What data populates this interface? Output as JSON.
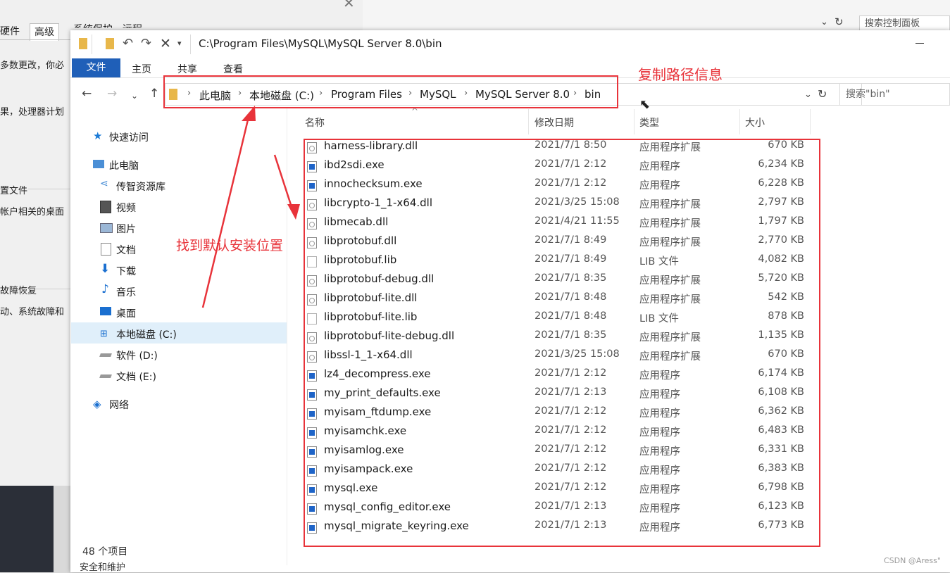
{
  "background_dialog": {
    "tabs": [
      "硬件",
      "高级",
      "系统保护",
      "远程"
    ],
    "lines": [
      "多数更改，你必",
      "果，处理器计划",
      "置文件",
      "帐户相关的桌面",
      "故障恢复",
      "动、系统故障和"
    ]
  },
  "control_panel": {
    "search_placeholder": "搜索控制面板"
  },
  "window": {
    "title_path": "C:\\Program Files\\MySQL\\MySQL Server 8.0\\bin",
    "ribbon_tabs": [
      "文件",
      "主页",
      "共享",
      "查看"
    ],
    "breadcrumb": [
      "此电脑",
      "本地磁盘 (C:)",
      "Program Files",
      "MySQL",
      "MySQL Server 8.0",
      "bin"
    ],
    "search_placeholder": "搜索\"bin\""
  },
  "nav_pane": {
    "items": [
      "快速访问",
      "此电脑",
      "传智资源库",
      "视频",
      "图片",
      "文档",
      "下载",
      "音乐",
      "桌面",
      "本地磁盘 (C:)",
      "软件 (D:)",
      "文档 (E:)",
      "网络"
    ]
  },
  "columns": [
    "名称",
    "修改日期",
    "类型",
    "大小"
  ],
  "files": [
    {
      "name": "harness-library.dll",
      "date": "2021/7/1 8:50",
      "type": "应用程序扩展",
      "size": "670 KB",
      "kind": "dll"
    },
    {
      "name": "ibd2sdi.exe",
      "date": "2021/7/1 2:12",
      "type": "应用程序",
      "size": "6,234 KB",
      "kind": "exe"
    },
    {
      "name": "innochecksum.exe",
      "date": "2021/7/1 2:12",
      "type": "应用程序",
      "size": "6,228 KB",
      "kind": "exe"
    },
    {
      "name": "libcrypto-1_1-x64.dll",
      "date": "2021/3/25 15:08",
      "type": "应用程序扩展",
      "size": "2,797 KB",
      "kind": "dll"
    },
    {
      "name": "libmecab.dll",
      "date": "2021/4/21 11:55",
      "type": "应用程序扩展",
      "size": "1,797 KB",
      "kind": "dll"
    },
    {
      "name": "libprotobuf.dll",
      "date": "2021/7/1 8:49",
      "type": "应用程序扩展",
      "size": "2,770 KB",
      "kind": "dll"
    },
    {
      "name": "libprotobuf.lib",
      "date": "2021/7/1 8:49",
      "type": "LIB 文件",
      "size": "4,082 KB",
      "kind": "lib"
    },
    {
      "name": "libprotobuf-debug.dll",
      "date": "2021/7/1 8:35",
      "type": "应用程序扩展",
      "size": "5,720 KB",
      "kind": "dll"
    },
    {
      "name": "libprotobuf-lite.dll",
      "date": "2021/7/1 8:48",
      "type": "应用程序扩展",
      "size": "542 KB",
      "kind": "dll"
    },
    {
      "name": "libprotobuf-lite.lib",
      "date": "2021/7/1 8:48",
      "type": "LIB 文件",
      "size": "878 KB",
      "kind": "lib"
    },
    {
      "name": "libprotobuf-lite-debug.dll",
      "date": "2021/7/1 8:35",
      "type": "应用程序扩展",
      "size": "1,135 KB",
      "kind": "dll"
    },
    {
      "name": "libssl-1_1-x64.dll",
      "date": "2021/3/25 15:08",
      "type": "应用程序扩展",
      "size": "670 KB",
      "kind": "dll"
    },
    {
      "name": "lz4_decompress.exe",
      "date": "2021/7/1 2:12",
      "type": "应用程序",
      "size": "6,174 KB",
      "kind": "exe"
    },
    {
      "name": "my_print_defaults.exe",
      "date": "2021/7/1 2:13",
      "type": "应用程序",
      "size": "6,108 KB",
      "kind": "exe"
    },
    {
      "name": "myisam_ftdump.exe",
      "date": "2021/7/1 2:12",
      "type": "应用程序",
      "size": "6,362 KB",
      "kind": "exe"
    },
    {
      "name": "myisamchk.exe",
      "date": "2021/7/1 2:12",
      "type": "应用程序",
      "size": "6,483 KB",
      "kind": "exe"
    },
    {
      "name": "myisamlog.exe",
      "date": "2021/7/1 2:12",
      "type": "应用程序",
      "size": "6,331 KB",
      "kind": "exe"
    },
    {
      "name": "myisampack.exe",
      "date": "2021/7/1 2:12",
      "type": "应用程序",
      "size": "6,383 KB",
      "kind": "exe"
    },
    {
      "name": "mysql.exe",
      "date": "2021/7/1 2:12",
      "type": "应用程序",
      "size": "6,798 KB",
      "kind": "exe"
    },
    {
      "name": "mysql_config_editor.exe",
      "date": "2021/7/1 2:13",
      "type": "应用程序",
      "size": "6,123 KB",
      "kind": "exe"
    },
    {
      "name": "mysql_migrate_keyring.exe",
      "date": "2021/7/1 2:13",
      "type": "应用程序",
      "size": "6,773 KB",
      "kind": "exe"
    }
  ],
  "status": {
    "item_count": "48 个项目",
    "bottom_link": "安全和维护"
  },
  "annotations": {
    "copy_path": "复制路径信息",
    "find_location": "找到默认安装位置",
    "color": "#e8333a"
  },
  "watermark": "CSDN @Aress\""
}
